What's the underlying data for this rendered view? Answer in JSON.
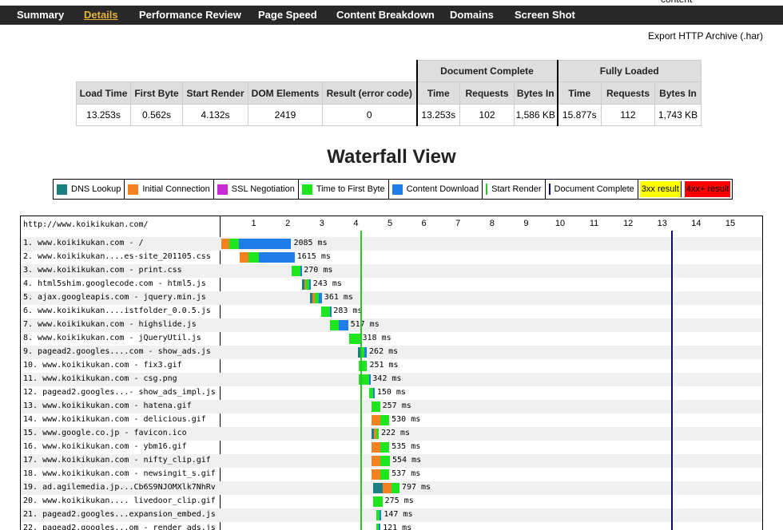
{
  "top_partial_text": "content",
  "nav": {
    "tabs": [
      {
        "label": "Summary",
        "active": false
      },
      {
        "label": "Details",
        "active": true
      },
      {
        "label": "Performance Review",
        "active": false
      },
      {
        "label": "Page Speed",
        "active": false
      },
      {
        "label": "Content Breakdown",
        "active": false
      },
      {
        "label": "Domains",
        "active": false
      },
      {
        "label": "Screen Shot",
        "active": false
      }
    ]
  },
  "export_label": "Export HTTP Archive (.har)",
  "summary": {
    "group_document": "Document Complete",
    "group_fully": "Fully Loaded",
    "headers": [
      "Load Time",
      "First Byte",
      "Start Render",
      "DOM Elements",
      "Result (error code)",
      "Time",
      "Requests",
      "Bytes In",
      "Time",
      "Requests",
      "Bytes In"
    ],
    "values": [
      "13.253s",
      "0.562s",
      "4.132s",
      "2419",
      "0",
      "13.253s",
      "102",
      "1,586 KB",
      "15.877s",
      "112",
      "1,743 KB"
    ]
  },
  "waterfall_title": "Waterfall View",
  "legend": [
    {
      "label": "DNS Lookup",
      "kind": "swatch",
      "color": "#1a7f80"
    },
    {
      "label": "Initial Connection",
      "kind": "swatch",
      "color": "#f58220"
    },
    {
      "label": "SSL Negotiation",
      "kind": "swatch",
      "color": "#c62bd6"
    },
    {
      "label": "Time to First Byte",
      "kind": "swatch",
      "color": "#1ee51e"
    },
    {
      "label": "Content Download",
      "kind": "swatch",
      "color": "#1e7de6"
    },
    {
      "label": "Start Render",
      "kind": "line",
      "color": "#28c728"
    },
    {
      "label": "Document Complete",
      "kind": "line",
      "color": "#0a0a7a"
    },
    {
      "label": "3xx result",
      "kind": "fill",
      "color": "#ffff00"
    },
    {
      "label": "4xx+ result",
      "kind": "fill",
      "color": "#ff0000"
    }
  ],
  "waterfall": {
    "page_url": "http://www.koikikukan.com/",
    "ticks": [
      "1",
      "2",
      "3",
      "4",
      "5",
      "6",
      "7",
      "8",
      "9",
      "10",
      "11",
      "12",
      "13",
      "14",
      "15"
    ],
    "start_render_s": 4.132,
    "doc_complete_s": 13.253,
    "rows": [
      {
        "label": "1. www.koikikukan.com - /",
        "duration": "2085 ms",
        "segs": [
          {
            "t": "conn",
            "s": 0.05,
            "e": 0.28
          },
          {
            "t": "ttfb",
            "s": 0.28,
            "e": 0.56
          },
          {
            "t": "dl",
            "s": 0.56,
            "e": 2.1
          }
        ]
      },
      {
        "label": "2. www.koikikukan....es-site_201105.css",
        "duration": "1615 ms",
        "segs": [
          {
            "t": "conn",
            "s": 0.58,
            "e": 0.85
          },
          {
            "t": "ttfb",
            "s": 0.85,
            "e": 1.15
          },
          {
            "t": "dl",
            "s": 1.15,
            "e": 2.2
          }
        ]
      },
      {
        "label": "3. www.koikikukan.com - print.css",
        "duration": "270 ms",
        "segs": [
          {
            "t": "ttfb",
            "s": 2.12,
            "e": 2.38
          },
          {
            "t": "dl",
            "s": 2.38,
            "e": 2.4
          }
        ]
      },
      {
        "label": "4. html5shim.googlecode.com - html5.js",
        "duration": "243 ms",
        "segs": [
          {
            "t": "dns",
            "s": 2.42,
            "e": 2.48
          },
          {
            "t": "conn",
            "s": 2.48,
            "e": 2.54
          },
          {
            "t": "ttfb",
            "s": 2.54,
            "e": 2.62
          },
          {
            "t": "dl",
            "s": 2.62,
            "e": 2.67
          }
        ]
      },
      {
        "label": "5. ajax.googleapis.com - jquery.min.js",
        "duration": "361 ms",
        "segs": [
          {
            "t": "dns",
            "s": 2.65,
            "e": 2.72
          },
          {
            "t": "conn",
            "s": 2.72,
            "e": 2.8
          },
          {
            "t": "ttfb",
            "s": 2.8,
            "e": 2.9
          },
          {
            "t": "dl",
            "s": 2.9,
            "e": 3.0
          }
        ]
      },
      {
        "label": "6. www.koikikukan....istfolder_0.0.5.js",
        "duration": "283 ms",
        "segs": [
          {
            "t": "ttfb",
            "s": 2.98,
            "e": 3.25
          },
          {
            "t": "dl",
            "s": 3.25,
            "e": 3.27
          }
        ]
      },
      {
        "label": "7. www.koikikukan.com - highslide.js",
        "duration": "517 ms",
        "segs": [
          {
            "t": "ttfb",
            "s": 3.25,
            "e": 3.5
          },
          {
            "t": "dl",
            "s": 3.5,
            "e": 3.77
          }
        ]
      },
      {
        "label": "8. www.koikikukan.com - jQueryUtil.js",
        "duration": "318 ms",
        "segs": [
          {
            "t": "ttfb",
            "s": 3.8,
            "e": 4.12
          }
        ]
      },
      {
        "label": "9. pagead2.googles....com - show_ads.js",
        "duration": "262 ms",
        "segs": [
          {
            "t": "dns",
            "s": 4.05,
            "e": 4.13
          },
          {
            "t": "conn",
            "s": 4.13,
            "e": 4.18
          },
          {
            "t": "ttfb",
            "s": 4.18,
            "e": 4.26
          },
          {
            "t": "dl",
            "s": 4.26,
            "e": 4.32
          }
        ]
      },
      {
        "label": "10. www.koikikukan.com - fix3.gif",
        "duration": "251 ms",
        "segs": [
          {
            "t": "ttfb",
            "s": 4.08,
            "e": 4.33
          }
        ]
      },
      {
        "label": "11. www.koikikukan.com - csg.png",
        "duration": "342 ms",
        "segs": [
          {
            "t": "ttfb",
            "s": 4.08,
            "e": 4.4
          },
          {
            "t": "dl",
            "s": 4.4,
            "e": 4.42
          }
        ]
      },
      {
        "label": "12. pagead2.googles...- show_ads_impl.js",
        "duration": "150 ms",
        "segs": [
          {
            "t": "ttfb",
            "s": 4.4,
            "e": 4.5
          },
          {
            "t": "dl",
            "s": 4.5,
            "e": 4.55
          }
        ]
      },
      {
        "label": "13. www.koikikukan.com - hatena.gif",
        "duration": "257 ms",
        "segs": [
          {
            "t": "ttfb",
            "s": 4.45,
            "e": 4.71
          }
        ]
      },
      {
        "label": "14. www.koikikukan.com - delicious.gif",
        "duration": "530 ms",
        "segs": [
          {
            "t": "conn",
            "s": 4.45,
            "e": 4.72
          },
          {
            "t": "ttfb",
            "s": 4.72,
            "e": 4.98
          }
        ]
      },
      {
        "label": "15. www.google.co.jp - favicon.ico",
        "duration": "222 ms",
        "segs": [
          {
            "t": "dns",
            "s": 4.45,
            "e": 4.52
          },
          {
            "t": "conn",
            "s": 4.52,
            "e": 4.6
          },
          {
            "t": "ttfb",
            "s": 4.6,
            "e": 4.67
          }
        ]
      },
      {
        "label": "16. www.koikikukan.com - ybm16.gif",
        "duration": "535 ms",
        "segs": [
          {
            "t": "conn",
            "s": 4.45,
            "e": 4.72
          },
          {
            "t": "ttfb",
            "s": 4.72,
            "e": 4.98
          }
        ]
      },
      {
        "label": "17. www.koikikukan.com - nifty_clip.gif",
        "duration": "554 ms",
        "segs": [
          {
            "t": "conn",
            "s": 4.45,
            "e": 4.72
          },
          {
            "t": "ttfb",
            "s": 4.72,
            "e": 5.0
          }
        ]
      },
      {
        "label": "18. www.koikikukan.com - newsingit_s.gif",
        "duration": "537 ms",
        "segs": [
          {
            "t": "conn",
            "s": 4.45,
            "e": 4.72
          },
          {
            "t": "ttfb",
            "s": 4.72,
            "e": 4.98
          }
        ]
      },
      {
        "label": "19. ad.agilemedia.jp...Cb6S9NJOMXlk7NhRv",
        "duration": "797 ms",
        "segs": [
          {
            "t": "dns",
            "s": 4.5,
            "e": 4.78
          },
          {
            "t": "conn",
            "s": 4.78,
            "e": 5.05
          },
          {
            "t": "ttfb",
            "s": 5.05,
            "e": 5.28
          }
        ]
      },
      {
        "label": "20. www.koikikukan.... livedoor_clip.gif",
        "duration": "275 ms",
        "segs": [
          {
            "t": "ttfb",
            "s": 4.5,
            "e": 4.78
          }
        ]
      },
      {
        "label": "21. pagead2.googles...expansion_embed.js",
        "duration": "147 ms",
        "segs": [
          {
            "t": "ttfb",
            "s": 4.6,
            "e": 4.7
          },
          {
            "t": "dl",
            "s": 4.7,
            "e": 4.75
          }
        ]
      },
      {
        "label": "22. pagead2.googles...om - render_ads.js",
        "duration": "121 ms",
        "segs": [
          {
            "t": "ttfb",
            "s": 4.6,
            "e": 4.68
          },
          {
            "t": "dl",
            "s": 4.68,
            "e": 4.72
          }
        ]
      }
    ]
  }
}
